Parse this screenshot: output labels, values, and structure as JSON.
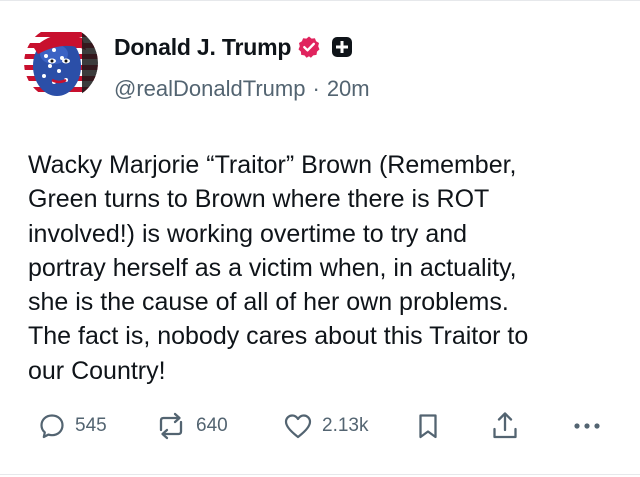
{
  "post": {
    "author": {
      "display_name": "Donald J. Trump",
      "handle": "@realDonaldTrump",
      "separator": "·",
      "time": "20m",
      "avatar_icon": "stars-and-stripes-portrait-avatar",
      "verified_icon": "verified-badge-icon",
      "plus_icon": "plus-badge-icon"
    },
    "text": "Wacky Marjorie “Traitor” Brown (Remember,\nGreen turns to Brown where there is ROT\ninvolved!) is working overtime to try and\nportray herself as a victim when, in actuality,\nshe is the cause of all of her own problems.\nThe fact is, nobody cares about this Traitor to\nour Country!",
    "actions": {
      "reply_count": "545",
      "repost_count": "640",
      "like_count": "2.13k"
    }
  },
  "colors": {
    "text_primary": "#0f1419",
    "text_secondary": "#536471",
    "verified_badge": "#e0245e",
    "divider": "#e6e8eb"
  }
}
